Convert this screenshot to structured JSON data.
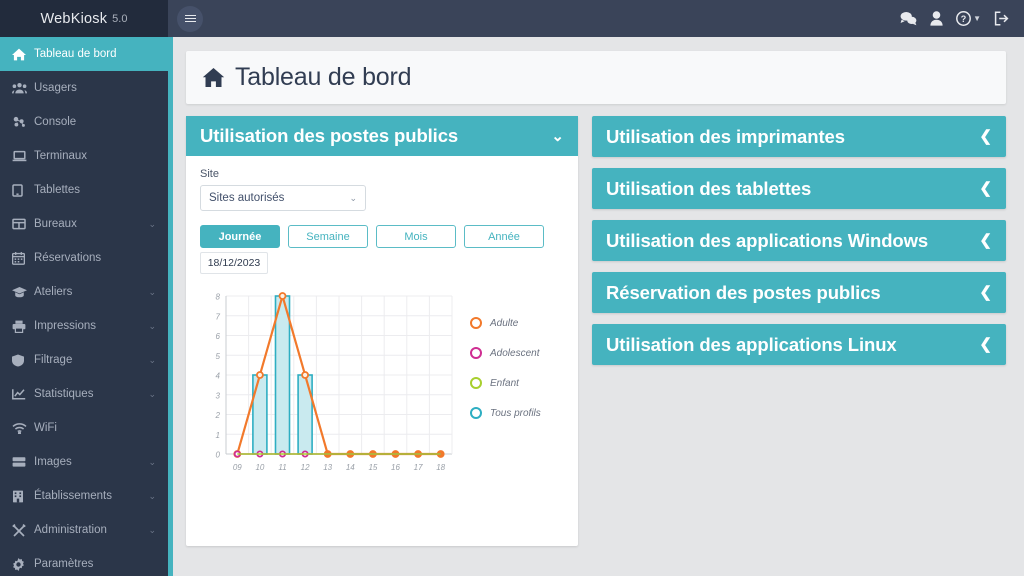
{
  "brand": {
    "name": "WebKiosk",
    "version": "5.0"
  },
  "sidebar": {
    "items": [
      {
        "label": "Tableau de bord",
        "icon": "home-icon",
        "active": true,
        "caret": false
      },
      {
        "label": "Usagers",
        "icon": "users-icon",
        "active": false,
        "caret": false
      },
      {
        "label": "Console",
        "icon": "console-icon",
        "active": false,
        "caret": false
      },
      {
        "label": "Terminaux",
        "icon": "laptop-icon",
        "active": false,
        "caret": false
      },
      {
        "label": "Tablettes",
        "icon": "tablet-icon",
        "active": false,
        "caret": false
      },
      {
        "label": "Bureaux",
        "icon": "grid-icon",
        "active": false,
        "caret": true
      },
      {
        "label": "Réservations",
        "icon": "calendar-icon",
        "active": false,
        "caret": false
      },
      {
        "label": "Ateliers",
        "icon": "graduation-icon",
        "active": false,
        "caret": true
      },
      {
        "label": "Impressions",
        "icon": "printer-icon",
        "active": false,
        "caret": true
      },
      {
        "label": "Filtrage",
        "icon": "shield-icon",
        "active": false,
        "caret": true
      },
      {
        "label": "Statistiques",
        "icon": "chart-line-icon",
        "active": false,
        "caret": true
      },
      {
        "label": "WiFi",
        "icon": "wifi-icon",
        "active": false,
        "caret": false
      },
      {
        "label": "Images",
        "icon": "server-icon",
        "active": false,
        "caret": true
      },
      {
        "label": "Établissements",
        "icon": "building-icon",
        "active": false,
        "caret": true
      },
      {
        "label": "Administration",
        "icon": "tools-icon",
        "active": false,
        "caret": true
      },
      {
        "label": "Paramètres",
        "icon": "gear-icon",
        "active": false,
        "caret": false
      }
    ]
  },
  "topbar": {
    "menu_toggle": "hamburger-icon",
    "icons": [
      {
        "name": "chat-icon"
      },
      {
        "name": "user-icon"
      },
      {
        "name": "help-icon"
      },
      {
        "name": "logout-icon"
      }
    ]
  },
  "page": {
    "title": "Tableau de bord",
    "icon": "home-icon"
  },
  "main_panel": {
    "title": "Utilisation des postes publics",
    "chevron": "chevron-down-icon",
    "site_label": "Site",
    "site_value": "Sites autorisés",
    "period_buttons": [
      {
        "label": "Journée",
        "active": true
      },
      {
        "label": "Semaine",
        "active": false
      },
      {
        "label": "Mois",
        "active": false
      },
      {
        "label": "Année",
        "active": false
      }
    ],
    "date_value": "18/12/2023"
  },
  "chart_data": {
    "type": "bar",
    "title": "",
    "xlabel": "",
    "ylabel": "",
    "categories": [
      "09",
      "10",
      "11",
      "12",
      "13",
      "14",
      "15",
      "16",
      "17",
      "18"
    ],
    "ylim": [
      0,
      8
    ],
    "yticks": [
      0,
      1,
      2,
      3,
      4,
      5,
      6,
      7,
      8
    ],
    "grid": true,
    "legend_position": "right",
    "series": [
      {
        "name": "Adulte",
        "color": "#f2792b",
        "type": "line",
        "values": [
          0,
          4,
          8,
          4,
          0,
          0,
          0,
          0,
          0,
          0
        ]
      },
      {
        "name": "Adolescent",
        "color": "#cf2e92",
        "type": "line",
        "values": [
          0,
          0,
          0,
          0,
          0,
          0,
          0,
          0,
          0,
          0
        ]
      },
      {
        "name": "Enfant",
        "color": "#a8cf2e",
        "type": "line",
        "values": [
          0,
          0,
          0,
          0,
          0,
          0,
          0,
          0,
          0,
          0
        ]
      },
      {
        "name": "Tous profils",
        "color": "#2eaec2",
        "type": "bar",
        "values": [
          0,
          4,
          8,
          4,
          0,
          0,
          0,
          0,
          0,
          0
        ]
      }
    ]
  },
  "accordion": {
    "items": [
      {
        "title": "Utilisation des imprimantes",
        "chevron": "chevron-left-icon"
      },
      {
        "title": "Utilisation des tablettes",
        "chevron": "chevron-left-icon"
      },
      {
        "title": "Utilisation des applications Windows",
        "chevron": "chevron-left-icon"
      },
      {
        "title": "Réservation des postes publics",
        "chevron": "chevron-left-icon"
      },
      {
        "title": "Utilisation des applications Linux",
        "chevron": "chevron-left-icon"
      }
    ]
  },
  "colors": {
    "accent_teal": "#45b3bf",
    "sidebar_dark": "#2b3649",
    "topbar": "#3a4459",
    "page_bg": "#e4e5e7"
  }
}
